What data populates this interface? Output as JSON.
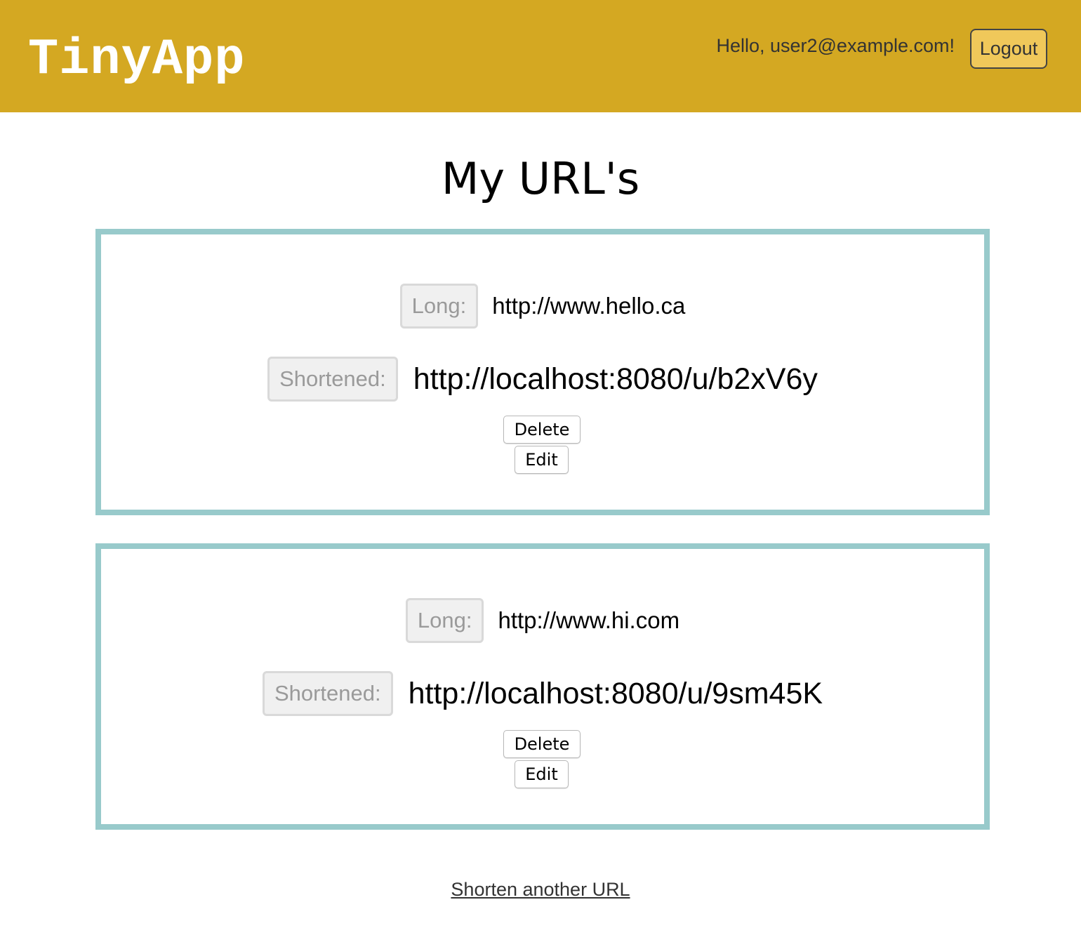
{
  "header": {
    "brand": "TinyApp",
    "greeting": "Hello, user2@example.com!",
    "logout_label": "Logout"
  },
  "main": {
    "title": "My URL's",
    "urls": [
      {
        "long_label": "Long:",
        "long_url": "http://www.hello.ca",
        "short_label": "Shortened:",
        "short_url": "http://localhost:8080/u/b2xV6y",
        "delete_label": "Delete",
        "edit_label": "Edit"
      },
      {
        "long_label": "Long:",
        "long_url": "http://www.hi.com",
        "short_label": "Shortened:",
        "short_url": "http://localhost:8080/u/9sm45K",
        "delete_label": "Delete",
        "edit_label": "Edit"
      }
    ]
  },
  "footer": {
    "shorten_link": "Shorten another URL"
  },
  "colors": {
    "header_bg": "#d4a822",
    "logout_bg": "#f0c85a",
    "card_border": "#98cacb"
  }
}
